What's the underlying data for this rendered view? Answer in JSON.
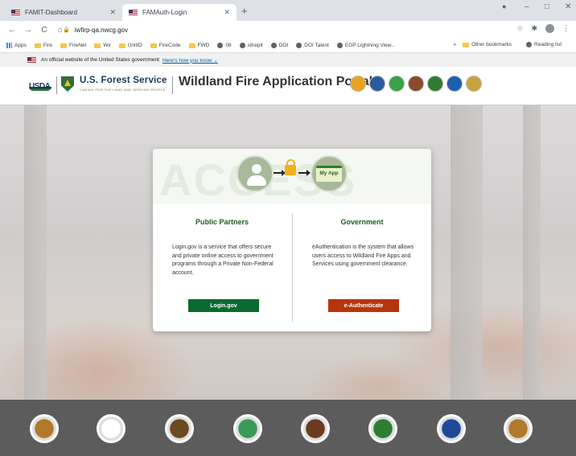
{
  "browser": {
    "tabs": [
      {
        "title": "FAMIT-Dashboard",
        "active": false
      },
      {
        "title": "FAMAuth-Login",
        "active": true
      }
    ],
    "new_tab_glyph": "+",
    "window_controls": [
      "–",
      "□",
      "✕"
    ],
    "nav": {
      "back": "←",
      "forward": "→",
      "reload": "C",
      "home": "⌂"
    },
    "url": "iwfirp-qa.nwcg.gov",
    "toolbar_icons": [
      "star-icon",
      "extensions-icon",
      "profile-icon",
      "menu-icon"
    ],
    "bookmarks": [
      "Apps",
      "Fire",
      "FireNet",
      "Wx",
      "UnitID",
      "FireCode",
      "FWD",
      "08",
      "sitrepit",
      "DOI",
      "DOI Talent",
      "EGP Lightning View..."
    ],
    "bookmarks_more": "»",
    "other_bookmarks": "Other bookmarks",
    "reading_list": "Reading list"
  },
  "gov_banner": {
    "text": "An official website of the United States government",
    "link": "Here's how you know"
  },
  "header": {
    "usda": "USDA",
    "agency": "U.S. Forest Service",
    "motto": "CARING FOR THE LAND AND SERVING PEOPLE",
    "portal_title": "Wildland Fire Application Portal",
    "agency_icon_colors": [
      "#e8a31c",
      "#2c5aa0",
      "#3aa04a",
      "#8b4a2b",
      "#2e7d32",
      "#1f5fae",
      "#c8a23a"
    ]
  },
  "card": {
    "watermark": "ACCESS",
    "my_app_label": "My App",
    "public": {
      "title": "Public Partners",
      "description": "Login.gov is a service that offers secure and private online access to government programs through a Private Non-Federal account.",
      "button": "Login.gov",
      "button_color": "#0b6b2f"
    },
    "government": {
      "title": "Government",
      "description": "eAuthentication is the system that allows users access to Wildland Fire Apps and Services using government clearance.",
      "button": "e-Authenticate",
      "button_color": "#b5360d"
    }
  },
  "footer": {
    "seals": [
      "blm-seal",
      "bia-seal",
      "forest-service-seal",
      "bor-seal",
      "nps-seal",
      "usda-seal",
      "dod-seal",
      "fws-seal"
    ],
    "seal_colors": [
      "#b07a2a",
      "#ffffff",
      "#6b4a1f",
      "#3a9a56",
      "#6b3a1f",
      "#2e7d32",
      "#1f4a9a",
      "#b07a2a"
    ]
  }
}
